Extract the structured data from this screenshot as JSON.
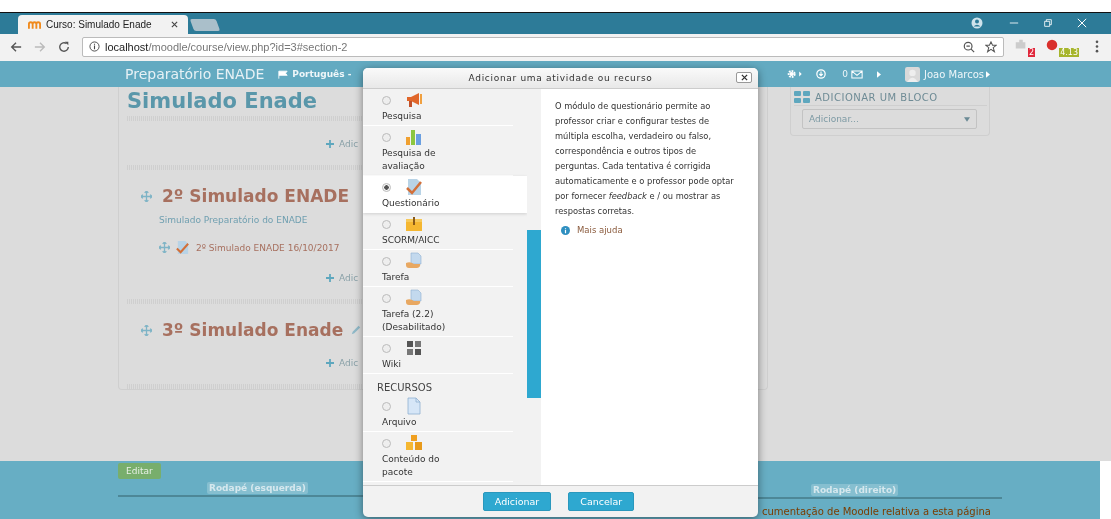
{
  "browser": {
    "tab_title": "Curso: Simulado Enade",
    "url_host": "localhost",
    "url_path": "/moodle/course/view.php?id=3#section-2",
    "extension_badges": [
      "2",
      "4.13"
    ]
  },
  "navbar": {
    "brand": "Preparatório ENADE",
    "language": "Português -",
    "messages_count": "0",
    "user": "Joao Marcos"
  },
  "course": {
    "title": "Simulado Enade",
    "sections": [
      {
        "add_link": "Adic"
      },
      {
        "title": "2º Simulado ENADE",
        "summary": "Simulado Preparatório do ENADE",
        "activities": [
          "2º Simulado ENADE 16/10/2017"
        ],
        "add_link": "Adic"
      },
      {
        "title": "3º Simulado Enade",
        "editable": true,
        "add_link": "Adic"
      }
    ]
  },
  "block": {
    "title": "ADICIONAR UM BLOCO",
    "select_placeholder": "Adicionar..."
  },
  "footer": {
    "edit_button": "Editar",
    "left_label": "Rodapé (esquerda)",
    "right_label": "Rodapé (direito)",
    "doc_link": "cumentação de Moodle relativa a esta página"
  },
  "modal": {
    "title": "Adicionar uma atividade ou recurso",
    "activities": [
      {
        "label": "Pesquisa",
        "kind": "megaphone",
        "selected": false
      },
      {
        "label": "Pesquisa de avaliação",
        "kind": "chart",
        "selected": false
      },
      {
        "label": "Questionário",
        "kind": "quiz",
        "selected": true
      },
      {
        "label": "SCORM/AICC",
        "kind": "box",
        "selected": false
      },
      {
        "label": "Tarefa",
        "kind": "assign",
        "selected": false
      },
      {
        "label": "Tarefa (2.2) (Desabilitado)",
        "kind": "assign",
        "selected": false
      },
      {
        "label": "Wiki",
        "kind": "wiki",
        "selected": false
      }
    ],
    "resources_heading": "RECURSOS",
    "resources": [
      {
        "label": "Arquivo",
        "kind": "file",
        "selected": false
      },
      {
        "label": "Conteúdo do pacote",
        "kind": "package",
        "selected": false
      }
    ],
    "description": "O módulo de questionário permite ao professor criar e configurar testes de múltipla escolha, verdadeiro ou falso, correspondência e outros tipos de perguntas. Cada tentativa é corrigida automaticamente e o professor pode optar por fornecer *feedback* e / ou mostrar as respostas corretas.",
    "help_link": "Mais ajuda",
    "buttons": [
      "Adicionar",
      "Cancelar"
    ]
  }
}
